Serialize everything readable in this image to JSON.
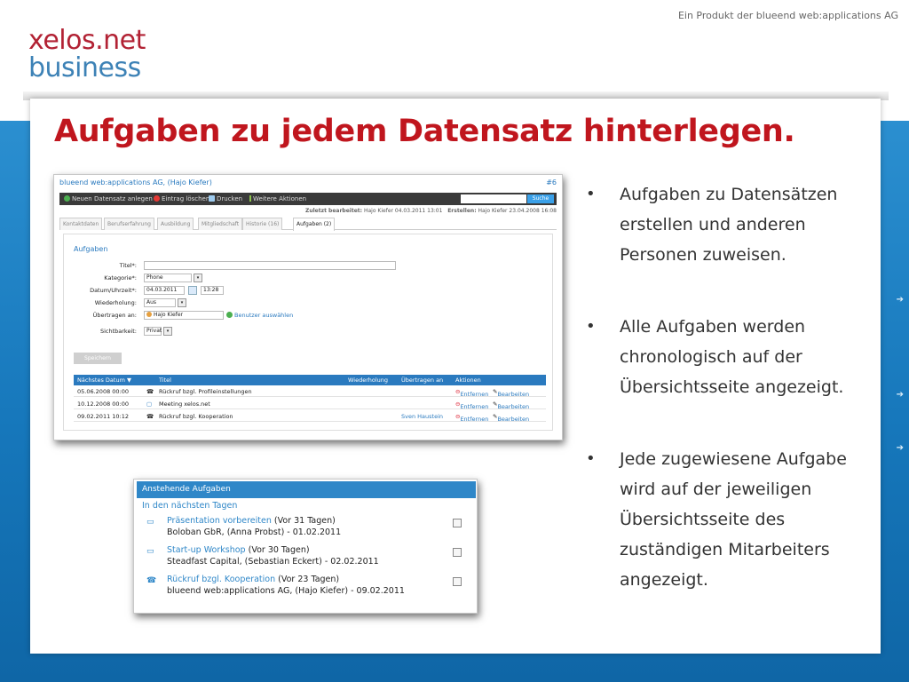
{
  "header": {
    "tagline": "Ein Produkt der blueend web:applications AG",
    "logo_line1": "xelos.net",
    "logo_line2": "business"
  },
  "title": "Aufgaben zu jedem Datensatz hinterlegen.",
  "bullets": [
    "Aufgaben zu Datensätzen erstellen und anderen Personen zuweisen.",
    "Alle Aufgaben werden chronologisch auf der Übersichtsseite angezeigt.",
    "Jede zugewiesene Aufgabe wird auf der jeweiligen Übersichtsseite des zuständigen Mitarbeiters angezeigt."
  ],
  "record": {
    "header": "blueend web:applications AG, (Hajo Kiefer)",
    "number": "#6",
    "toolbar": {
      "new": "Neuen Datensatz anlegen",
      "delete": "Eintrag löschen",
      "print": "Drucken",
      "more": "Weitere Aktionen",
      "search": "Suche"
    },
    "meta": {
      "edited_label": "Zuletzt bearbeitet:",
      "edited": "Hajo Kiefer 04.03.2011 13:01",
      "created_label": "Erstellen:",
      "created": "Hajo Kiefer 23.04.2008 16:08"
    },
    "tabs": [
      "Kontaktdaten",
      "Berufserfahrung",
      "Ausbildung",
      "Mitgliedschaft",
      "Historie (16)",
      "Aufgaben (2)"
    ],
    "section": "Aufgaben",
    "form": {
      "title_label": "Titel*:",
      "title_value": "",
      "category_label": "Kategorie*:",
      "category_value": "Phone",
      "datetime_label": "Datum/Uhrzeit*:",
      "date_value": "04.03.2011",
      "time_value": "13:28",
      "repeat_label": "Wiederholung:",
      "repeat_value": "Aus",
      "assign_label": "Übertragen an:",
      "assign_value": "Hajo Kiefer",
      "assign_link": "Benutzer auswählen",
      "visibility_label": "Sichtbarkeit:",
      "visibility_value": "Privat",
      "save": "Speichern"
    },
    "table": {
      "headers": [
        "Nächstes Datum ▼",
        "Titel",
        "Wiederholung",
        "Übertragen an",
        "Aktionen"
      ],
      "rows": [
        {
          "date": "05.06.2008 00:00",
          "title": "Rückruf bzgl. Profileinstellungen",
          "assigned": "",
          "remove": "Entfernen",
          "edit": "Bearbeiten"
        },
        {
          "date": "10.12.2008 00:00",
          "title": "Meeting xelos.net",
          "assigned": "",
          "remove": "Entfernen",
          "edit": "Bearbeiten"
        },
        {
          "date": "09.02.2011 10:12",
          "title": "Rückruf bzgl. Kooperation",
          "assigned": "Sven Haustein",
          "remove": "Entfernen",
          "edit": "Bearbeiten"
        }
      ]
    }
  },
  "widget": {
    "header": "Anstehende Aufgaben",
    "subheader": "In den nächsten Tagen",
    "items": [
      {
        "link": "Präsentation vorbereiten",
        "rel": "(Vor 31 Tagen)",
        "line2": "Boloban GbR, (Anna Probst) - 01.02.2011",
        "icon": "chat-icon"
      },
      {
        "link": "Start-up Workshop",
        "rel": "(Vor 30 Tagen)",
        "line2": "Steadfast Capital, (Sebastian Eckert) - 02.02.2011",
        "icon": "chat-icon"
      },
      {
        "link": "Rückruf bzgl. Kooperation",
        "rel": "(Vor 23 Tagen)",
        "line2": "blueend web:applications AG, (Hajo Kiefer) - 09.02.2011",
        "icon": "phone-icon"
      }
    ]
  },
  "colors": {
    "brand_red": "#c0161e",
    "brand_blue": "#3d82b6",
    "band_blue": "#1677bb",
    "link_blue": "#2a7abf"
  }
}
